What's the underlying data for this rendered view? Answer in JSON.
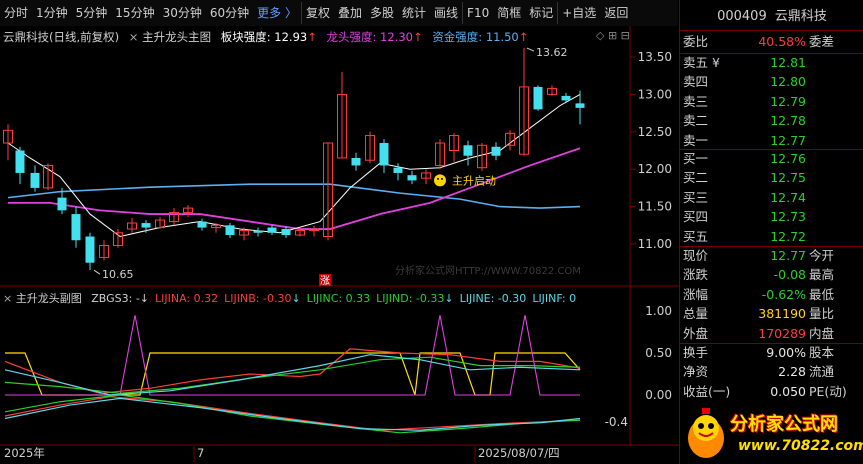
{
  "toolbar": {
    "items": [
      "分时",
      "1分钟",
      "5分钟",
      "15分钟",
      "30分钟",
      "60分钟",
      "更多 〉",
      "复权",
      "叠加",
      "多股",
      "统计",
      "画线",
      "F10",
      "简框",
      "标记",
      "+自选",
      "返回"
    ]
  },
  "header": {
    "stock_label": "云鼎科技(日线,前复权)",
    "indicator_label": "主升龙头主图",
    "sector_label": "板块强度:",
    "sector_value": "12.93",
    "leader_label": "龙头强度:",
    "leader_value": "12.30",
    "fund_label": "资金强度:",
    "fund_value": "11.50"
  },
  "main_chart": {
    "price_ticks": [
      "13.50",
      "13.00",
      "12.50",
      "12.00",
      "11.50",
      "11.00"
    ],
    "high_label": "13.62",
    "low_label": "10.65",
    "signal_label": "主升启动",
    "limit_label": "涨",
    "watermark": "分析家公式网HTTP://WWW.70822.COM"
  },
  "sub_chart": {
    "title": "主升龙头副图",
    "items": [
      {
        "label": "ZBGS3: -",
        "color": "#d0d0d0"
      },
      {
        "label": "LIJINA: 0.32",
        "color": "#ff3c3c"
      },
      {
        "label": "LIJINB: -0.30",
        "color": "#ff3c3c"
      },
      {
        "label": "LIJINC: 0.33",
        "color": "#2ad02a"
      },
      {
        "label": "LIJIND: -0.33",
        "color": "#2ad02a"
      },
      {
        "label": "LIJINE: -0.30",
        "color": "#5ad8e8"
      },
      {
        "label": "LIJINF: 0",
        "color": "#5ad8e8"
      }
    ],
    "ticks": [
      "1.00",
      "0.50",
      "0.00",
      "-0.4"
    ]
  },
  "date_axis": {
    "labels": [
      "2025年",
      "7",
      "2025/08/07/四"
    ]
  },
  "quote": {
    "code": "000409",
    "name": "云鼎科技",
    "webi_label": "委比",
    "webi_value": "40.58%",
    "weicha_label": "委差",
    "asks": [
      {
        "label": "卖五 ¥",
        "price": "12.81"
      },
      {
        "label": "卖四",
        "price": "12.80"
      },
      {
        "label": "卖三",
        "price": "12.79"
      },
      {
        "label": "卖二",
        "price": "12.78"
      },
      {
        "label": "卖一",
        "price": "12.77"
      }
    ],
    "bids": [
      {
        "label": "买一",
        "price": "12.76"
      },
      {
        "label": "买二",
        "price": "12.75"
      },
      {
        "label": "买三",
        "price": "12.74"
      },
      {
        "label": "买四",
        "price": "12.73"
      },
      {
        "label": "买五",
        "price": "12.72"
      }
    ],
    "stats": [
      {
        "label": "现价",
        "value": "12.77",
        "color": "#2ad02a",
        "label2": "今开"
      },
      {
        "label": "涨跌",
        "value": "-0.08",
        "color": "#2ad02a",
        "label2": "最高"
      },
      {
        "label": "涨幅",
        "value": "-0.62%",
        "color": "#2ad02a",
        "label2": "最低"
      },
      {
        "label": "总量",
        "value": "381190",
        "color": "#ffd700",
        "label2": "量比"
      },
      {
        "label": "外盘",
        "value": "170289",
        "color": "#ff3c3c",
        "label2": "内盘"
      }
    ],
    "stats2": [
      {
        "label": "换手",
        "value": "9.00%",
        "label2": "股本"
      },
      {
        "label": "净资",
        "value": "2.28",
        "label2": "流通"
      },
      {
        "label": "收益(一)",
        "value": "0.050",
        "label2": "PE(动)"
      }
    ]
  },
  "logo": {
    "text": "分析家公式网",
    "url": "www.70822.com"
  },
  "colors": {
    "up": "#ff3c3c",
    "down": "#44e0f0",
    "ma_white": "#ffffff",
    "ma_magenta": "#e040e0",
    "ma_blue": "#5ab0f0"
  }
}
